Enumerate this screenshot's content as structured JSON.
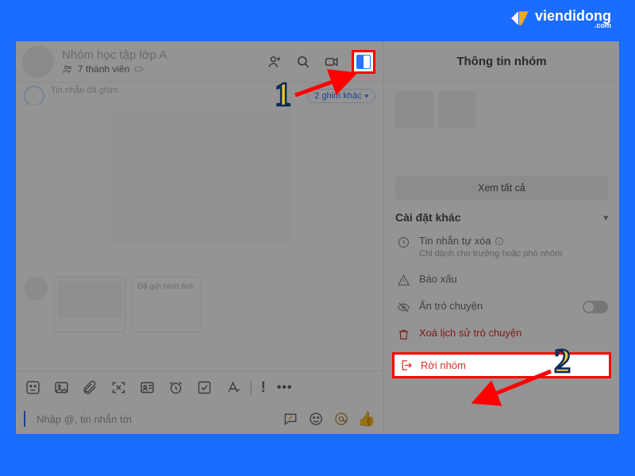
{
  "brand": {
    "name": "viendidong",
    "sub": ".com"
  },
  "chat": {
    "group_title": "Nhóm học tập lớp A",
    "members_label": "7 thành viên",
    "pins_label": "2 ghim khác",
    "pin_snippet": "Tin nhắn đã ghim",
    "bubble_text": "Đã gửi hình ảnh",
    "input_placeholder": "Nhập @, tin nhắn tới"
  },
  "info": {
    "title": "Thông tin nhóm",
    "see_all": "Xem tất cả",
    "settings_header": "Cài đặt khác",
    "auto_delete": {
      "label": "Tin nhắn tự xóa",
      "sub": "Chỉ dành cho trưởng hoặc phó nhóm"
    },
    "report": "Báo xấu",
    "hide_chat": "Ẩn trò chuyện",
    "clear_history": "Xoá lịch sử trò chuyện",
    "leave": "Rời nhóm"
  },
  "annotations": {
    "step1": "1",
    "step2": "2"
  }
}
